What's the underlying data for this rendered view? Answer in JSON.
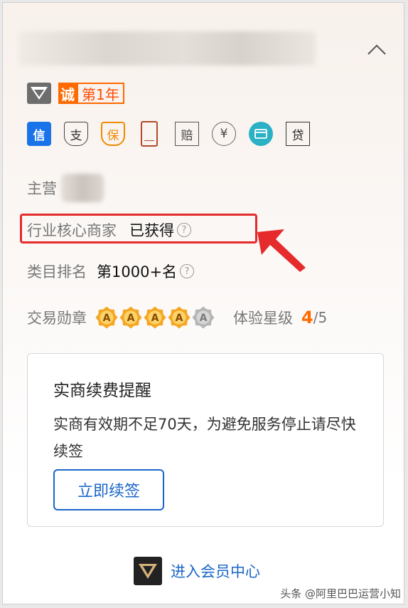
{
  "badges": {
    "cheng_char": "诚",
    "year_label": "第1年"
  },
  "service_icons": {
    "xin": "信",
    "zhi": "支",
    "bao": "保",
    "pei": "赔",
    "yuan": "¥",
    "dai": "贷"
  },
  "rows": {
    "main_label": "主营",
    "core_label": "行业核心商家",
    "core_value": "已获得",
    "rank_label": "类目排名",
    "rank_value": "第1000+名",
    "medal_label": "交易勋章",
    "medal_char": "A",
    "medals_active": 4,
    "medals_total": 5,
    "star_label": "体验星级",
    "star_value": "4",
    "star_total": "/5"
  },
  "help_char": "?",
  "notice": {
    "title": "实商续费提醒",
    "body": "实商有效期不足70天，为避免服务停止请尽快续签",
    "button": "立即续签"
  },
  "member_link": "进入会员中心",
  "watermark": "头条 @阿里巴巴运营小知",
  "colors": {
    "accent_orange": "#ff6a00",
    "link_blue": "#1a66c8",
    "highlight_red": "#e52b2b",
    "medal_gold": "#f5a623",
    "medal_gray": "#b5b5b5"
  }
}
